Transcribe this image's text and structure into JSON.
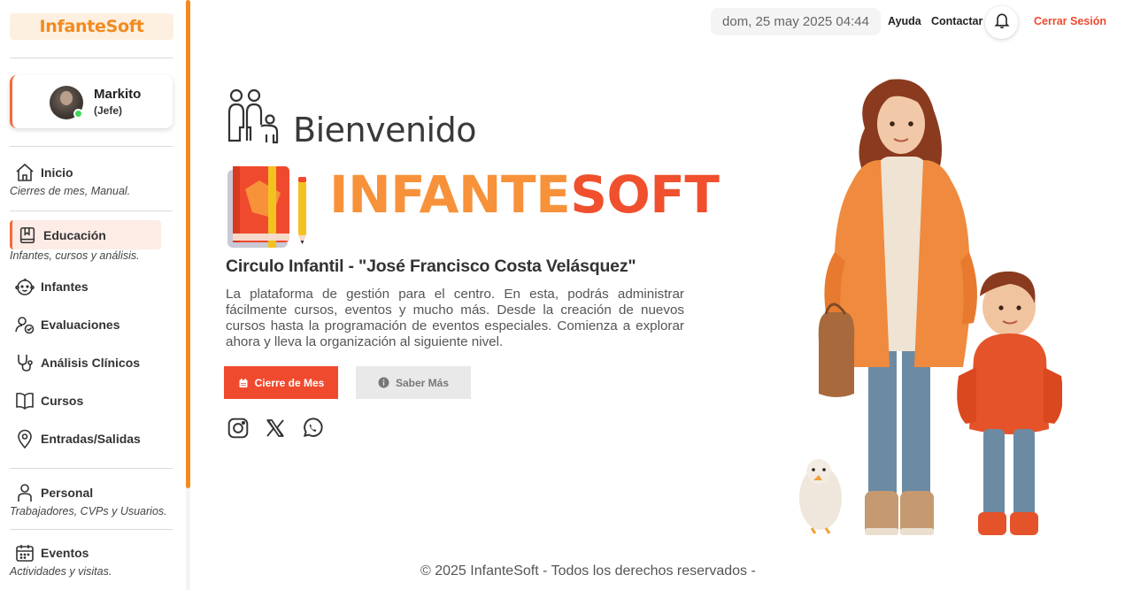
{
  "app": {
    "logo": "InfanteSoft"
  },
  "user": {
    "name": "Markito",
    "role": "(Jefe)"
  },
  "sidebar": {
    "items": [
      {
        "label": "Inicio",
        "sub": "Cierres de mes, Manual.",
        "icon": "home-icon"
      },
      {
        "label": "Educación",
        "sub": "Infantes, cursos y análisis.",
        "icon": "book-icon",
        "active": true
      },
      {
        "label": "Infantes",
        "icon": "baby-face-icon"
      },
      {
        "label": "Evaluaciones",
        "icon": "evaluation-icon"
      },
      {
        "label": "Análisis Clínicos",
        "icon": "stethoscope-icon"
      },
      {
        "label": "Cursos",
        "icon": "open-book-icon"
      },
      {
        "label": "Entradas/Salidas",
        "icon": "location-pin-icon"
      },
      {
        "label": "Personal",
        "sub": "Trabajadores, CVPs y Usuarios.",
        "icon": "person-icon"
      },
      {
        "label": "Eventos",
        "sub": "Actividades y visitas.",
        "icon": "calendar-icon"
      }
    ]
  },
  "header": {
    "datetime": "dom, 25 may 2025 04:44",
    "help": "Ayuda",
    "contact": "Contactar",
    "logout": "Cerrar Sesión"
  },
  "hero": {
    "welcome": "Bienvenido",
    "brand_part1": "INFANTE",
    "brand_part2": "SOFT",
    "center_name": "Circulo Infantil - \"José Francisco Costa Velásquez\"",
    "description": "La plataforma de gestión para el centro. En esta, podrás administrar fácilmente cursos, eventos y mucho más. Desde la creación de nuevos cursos hasta la programación de eventos especiales. Comienza a explorar ahora y lleva la organización al siguiente nivel.",
    "primary_button": "Cierre de Mes",
    "secondary_button": "Saber Más"
  },
  "social": [
    "instagram-icon",
    "x-icon",
    "whatsapp-icon"
  ],
  "footer": {
    "text": "© 2025 InfanteSoft - Todos los derechos reservados -"
  },
  "colors": {
    "accent": "#f28a1e",
    "brand_red": "#f04a2e",
    "brand_orange": "#f7923a"
  }
}
